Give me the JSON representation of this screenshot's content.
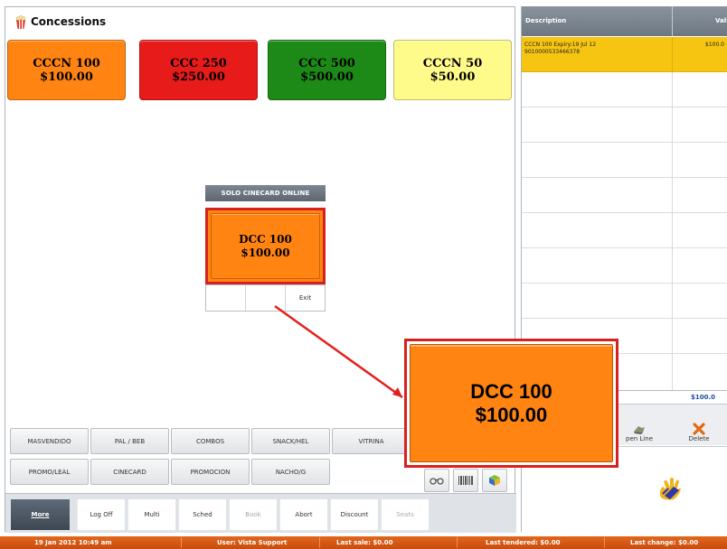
{
  "window": {
    "title": "Concessions"
  },
  "top_buttons": [
    {
      "name": "CCCN 100",
      "price": "$100.00",
      "color": "#ff8412"
    },
    {
      "name": "CCC 250",
      "price": "$250.00",
      "color": "#e81b1b"
    },
    {
      "name": "CCC 500",
      "price": "$500.00",
      "color": "#1d8a17"
    },
    {
      "name": "CCCN 50",
      "price": "$50.00",
      "color": "#fffb8a"
    }
  ],
  "solo_group": {
    "header": "SOLO CINECARD ONLINE",
    "item_name": "DCC 100",
    "item_price": "$100.00",
    "exit_label": "Exit"
  },
  "callout": {
    "item_name": "DCC 100",
    "item_price": "$100.00",
    "accent": "#d6221e"
  },
  "categories_row1": [
    "MASVENDIDO",
    "PAL / BEB",
    "COMBOS",
    "SNACK/HEL",
    "VITRINA"
  ],
  "categories_row2": [
    "PROMO/LEAL",
    "CINECARD",
    "PROMOCION",
    "NACHO/G"
  ],
  "icon_buttons": [
    "glasses-icon",
    "barcode-icon",
    "cube-icon"
  ],
  "nav": {
    "more": "More",
    "items": [
      {
        "label": "Log Off",
        "enabled": true
      },
      {
        "label": "Multi",
        "enabled": true
      },
      {
        "label": "Sched",
        "enabled": true
      },
      {
        "label": "Book",
        "enabled": false
      },
      {
        "label": "Abort",
        "enabled": true
      },
      {
        "label": "Discount",
        "enabled": true
      },
      {
        "label": "Seats",
        "enabled": false
      }
    ]
  },
  "order": {
    "col_description": "Description",
    "col_value": "Valu",
    "selected_row": {
      "line1": "CCCN 100 Expiry:19 Jul 12",
      "line2": "9010000533466378",
      "value": "$100.0"
    },
    "total": "$100.0",
    "actions": {
      "open_line": "pen Line",
      "delete": "Delete"
    },
    "highlight_color": "#f6c511"
  },
  "status_bar": {
    "datetime": "19 Jan 2012 10:49 am",
    "user": "User: Vista Support",
    "last_sale": "Last sale: $0.00",
    "last_tendered": "Last tendered: $0.00",
    "last_change": "Last change: $0.00",
    "color": "#d9561a"
  }
}
